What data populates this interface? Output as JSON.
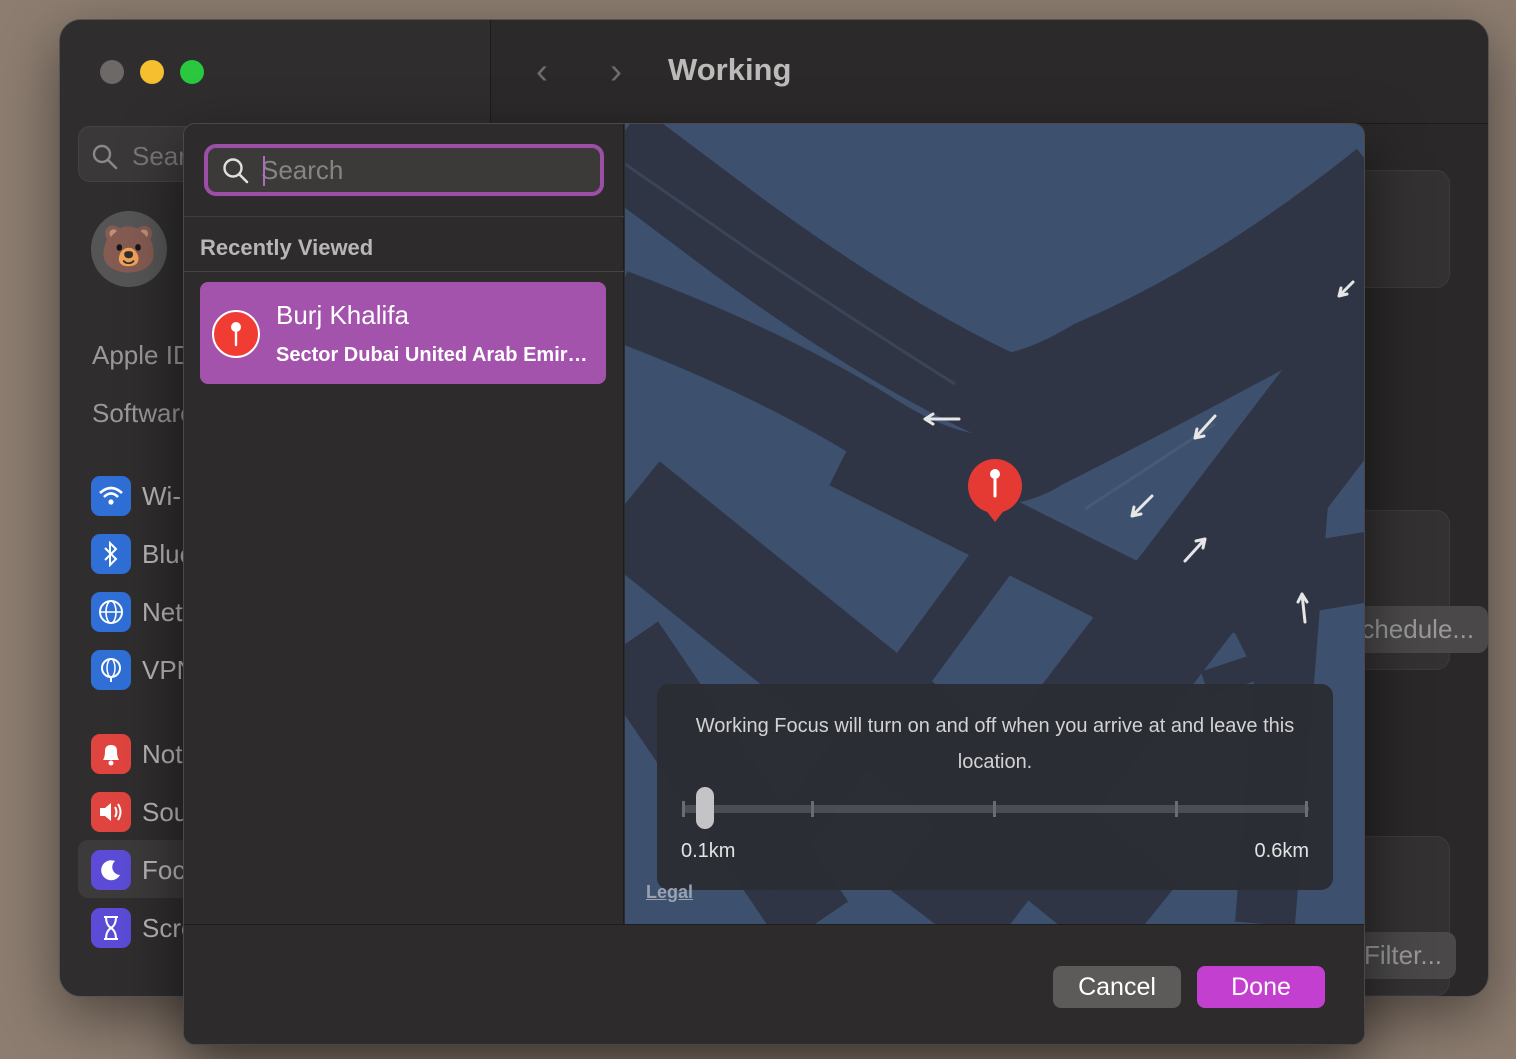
{
  "window": {
    "title": "Working",
    "nav_back": "‹",
    "nav_forward": "›"
  },
  "sidebar": {
    "search_placeholder": "Search",
    "apple_id": "Apple ID",
    "software": "Software Update",
    "items": [
      {
        "label": "Wi-Fi",
        "icon": "wifi-icon",
        "color": "#2f6fd6"
      },
      {
        "label": "Bluetooth",
        "icon": "bluetooth-icon",
        "color": "#2f6fd6"
      },
      {
        "label": "Network",
        "icon": "globe-icon",
        "color": "#2f6fd6"
      },
      {
        "label": "VPN",
        "icon": "vpn-globe-icon",
        "color": "#2f6fd6"
      },
      {
        "label": "Notifications",
        "icon": "bell-icon",
        "color": "#e0443f"
      },
      {
        "label": "Sound",
        "icon": "speaker-icon",
        "color": "#e0443f"
      },
      {
        "label": "Focus",
        "icon": "moon-icon",
        "color": "#5b4bd6"
      },
      {
        "label": "Screen Time",
        "icon": "hourglass-icon",
        "color": "#5b4bd6"
      }
    ]
  },
  "background_buttons": {
    "schedule": "Schedule...",
    "filter": "Filter..."
  },
  "sheet": {
    "search": {
      "placeholder": "Search",
      "value": ""
    },
    "recently_viewed_label": "Recently Viewed",
    "result": {
      "name": "Burj Khalifa",
      "address": "Sector Dubai United Arab Emirates"
    },
    "info": {
      "message": "Working Focus will turn on and off when you arrive at and leave this location.",
      "min_label": "0.1km",
      "max_label": "0.6km",
      "slider_value_km": 0.1
    },
    "legal": "Legal",
    "cancel": "Cancel",
    "done": "Done"
  },
  "colors": {
    "accent": "#c33fcf",
    "selection": "#a453ad",
    "map": "#3d506e",
    "pin": "#f03c33"
  }
}
